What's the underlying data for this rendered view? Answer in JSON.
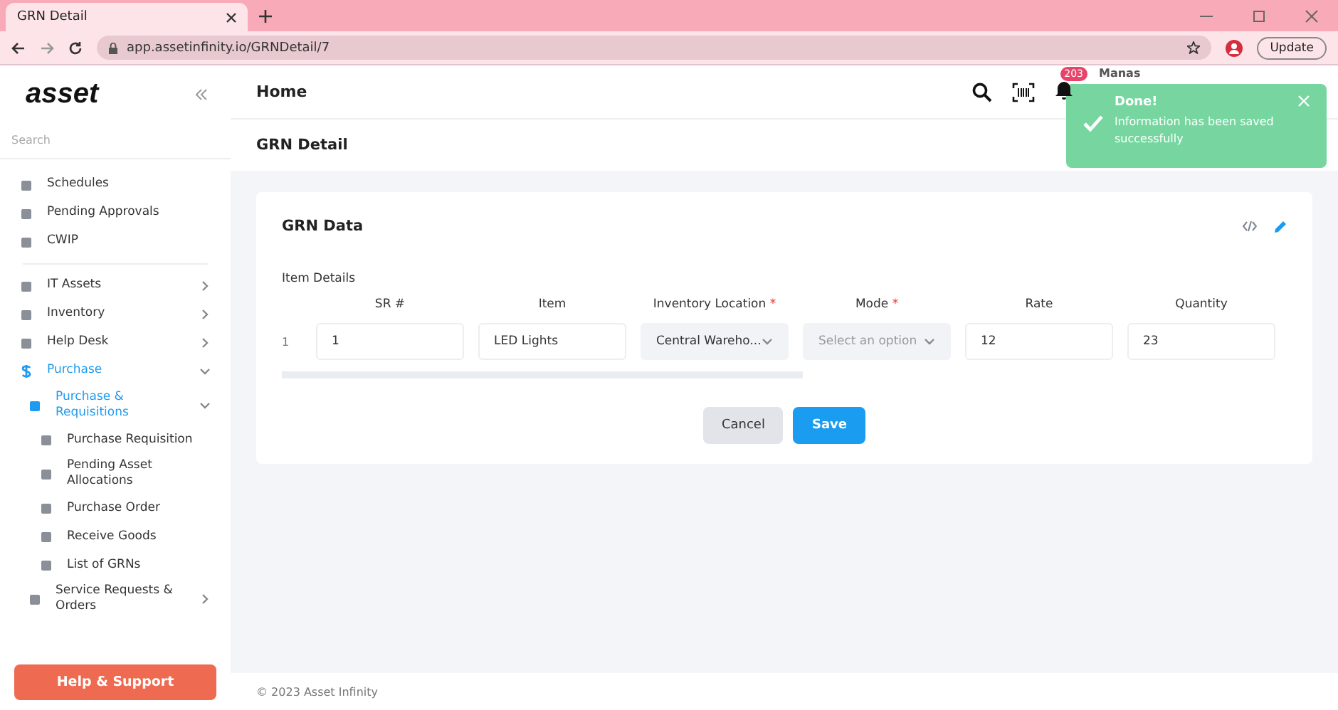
{
  "browser": {
    "tab_title": "GRN Detail",
    "url": "app.assetinfinity.io/GRNDetail/7",
    "update_button": "Update"
  },
  "sidebar": {
    "logo": "asset",
    "search_placeholder": "Search",
    "help_button": "Help & Support",
    "items": [
      {
        "label": "Schedules",
        "active": false
      },
      {
        "label": "Pending Approvals",
        "active": false
      },
      {
        "label": "CWIP",
        "active": false
      },
      {
        "label": "IT Assets",
        "active": false,
        "expanded": false
      },
      {
        "label": "Inventory",
        "active": false,
        "expanded": false
      },
      {
        "label": "Help Desk",
        "active": false,
        "expanded": false
      },
      {
        "label": "Purchase",
        "active": true,
        "expanded": true,
        "children": [
          {
            "label": "Purchase & Requisitions",
            "active": true,
            "expanded": true,
            "children": [
              {
                "label": "Purchase Requisition",
                "active": false
              },
              {
                "label": "Pending Asset Allocations",
                "active": false
              },
              {
                "label": "Purchase Order",
                "active": false
              },
              {
                "label": "Receive Goods",
                "active": false
              },
              {
                "label": "List of GRNs",
                "active": false
              }
            ]
          },
          {
            "label": "Service Requests & Orders",
            "active": false,
            "expanded": false
          }
        ]
      }
    ]
  },
  "header": {
    "title": "Home",
    "notification_count": "203",
    "user_name": "Manas"
  },
  "toast": {
    "title": "Done!",
    "message": "Information has been saved successfully"
  },
  "page_title": "GRN Detail",
  "card": {
    "title": "GRN Data",
    "section": "Item Details",
    "columns": [
      {
        "label": "SR #"
      },
      {
        "label": "Item"
      },
      {
        "label": "Inventory Location",
        "required_mark": "*"
      },
      {
        "label": "Mode",
        "required_mark": "*"
      },
      {
        "label": "Rate"
      },
      {
        "label": "Quantity"
      }
    ],
    "rows": [
      {
        "index": "1",
        "cells": [
          {
            "kind": "input",
            "value": "1"
          },
          {
            "kind": "input",
            "value": "LED Lights"
          },
          {
            "kind": "select",
            "value": "Central Wareho..."
          },
          {
            "kind": "select",
            "placeholder": "Select an option"
          },
          {
            "kind": "input",
            "value": "12"
          },
          {
            "kind": "input",
            "value": "23"
          }
        ]
      }
    ],
    "buttons": [
      {
        "label": "Cancel",
        "kind": "secondary"
      },
      {
        "label": "Save",
        "kind": "primary"
      }
    ]
  },
  "footer": "© 2023 Asset Infinity"
}
